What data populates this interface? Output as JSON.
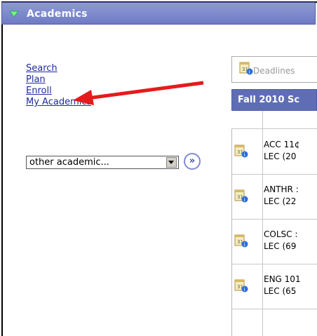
{
  "header": {
    "title": "Academics"
  },
  "links": [
    "Search",
    "Plan",
    "Enroll",
    "My Academics"
  ],
  "select": {
    "value": "other academic..."
  },
  "go_label": "»",
  "panel": {
    "deadlines_label": "Deadlines",
    "term_title": "Fall 2010 Sc",
    "rows": [
      {
        "course": "ACC 11¢",
        "section": "LEC (20"
      },
      {
        "course": "ANTHR :",
        "section": "LEC (22"
      },
      {
        "course": "COLSC :",
        "section": "LEC (69"
      },
      {
        "course": "ENG 101",
        "section": "LEC (65"
      }
    ]
  },
  "colors": {
    "header": "#6e7cc4",
    "link": "#1f2a9e",
    "arrow": "#e51b1b"
  }
}
